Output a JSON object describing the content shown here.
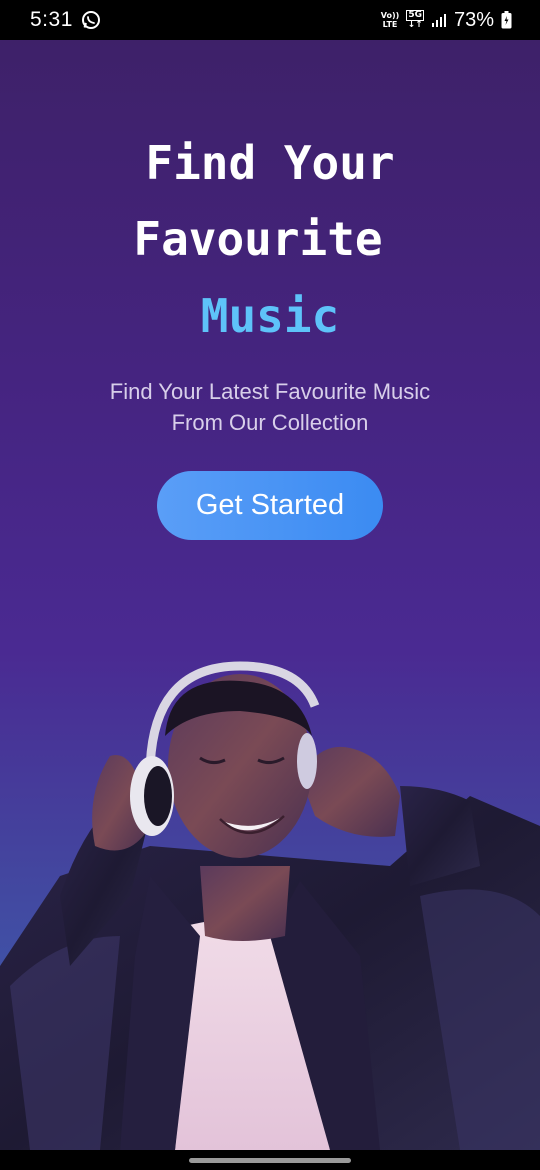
{
  "status_bar": {
    "time": "5:31",
    "network_badge": "Vo)) LTE",
    "network_type": "5G",
    "battery_percent": "73%",
    "icons": [
      "whatsapp-icon",
      "volte-icon",
      "5g-icon",
      "signal-icon",
      "battery-icon"
    ]
  },
  "hero": {
    "title_line1": "Find Your",
    "title_line2": "Favourite",
    "title_line3": "Music",
    "subtitle_line1": "Find Your Latest Favourite Music",
    "subtitle_line2": "From Our Collection",
    "cta_label": "Get Started"
  },
  "colors": {
    "background_top": "#3e2169",
    "background_bottom": "#3a66b4",
    "accent_text": "#5ec3f9",
    "button": "#4a94f4"
  }
}
